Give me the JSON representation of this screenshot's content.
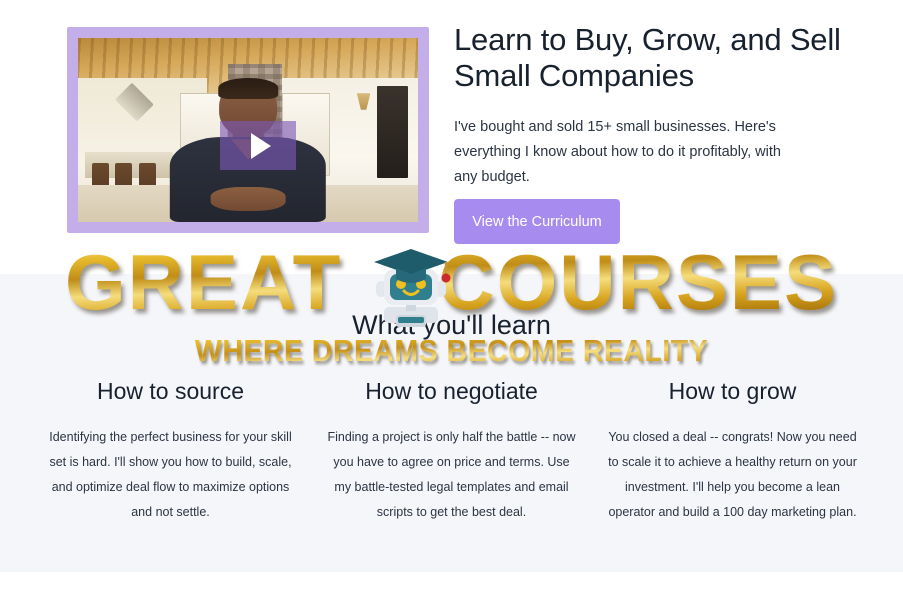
{
  "hero": {
    "title": "Learn to Buy, Grow, and Sell Small Companies",
    "subtitle": "I've bought and sold 15+ small businesses. Here's everything I know about how to do it profitably, with any budget.",
    "cta_label": "View the Curriculum",
    "video": {
      "play_icon": "play-icon",
      "border_color": "#c4aeea",
      "overlay_color": "#7c58b8"
    }
  },
  "learn": {
    "heading": "What you'll learn",
    "columns": [
      {
        "heading": "How to source",
        "body": "Identifying the perfect business for your skill set is hard. I'll show you how to build, scale, and optimize deal flow to maximize options and not settle."
      },
      {
        "heading": "How to negotiate",
        "body": "Finding a project is only half the battle -- now you have to agree on price and terms. Use my battle-tested legal templates and email scripts to get the best deal."
      },
      {
        "heading": "How to grow",
        "body": "You closed a deal -- congrats! Now you need to scale it to achieve a healthy return on your investment. I'll help you become a lean operator and build a 100 day marketing plan."
      }
    ]
  },
  "watermark": {
    "word_left": "GREAT",
    "word_right": "COURSES",
    "tagline": "WHERE DREAMS BECOME REALITY",
    "mascot_icon": "graduate-robot-icon",
    "gold_color": "#e0b12c"
  },
  "colors": {
    "accent_purple": "#a78bef",
    "section_background": "#f5f6fa",
    "page_background": "#ffffff",
    "text_dark": "#18212e"
  }
}
